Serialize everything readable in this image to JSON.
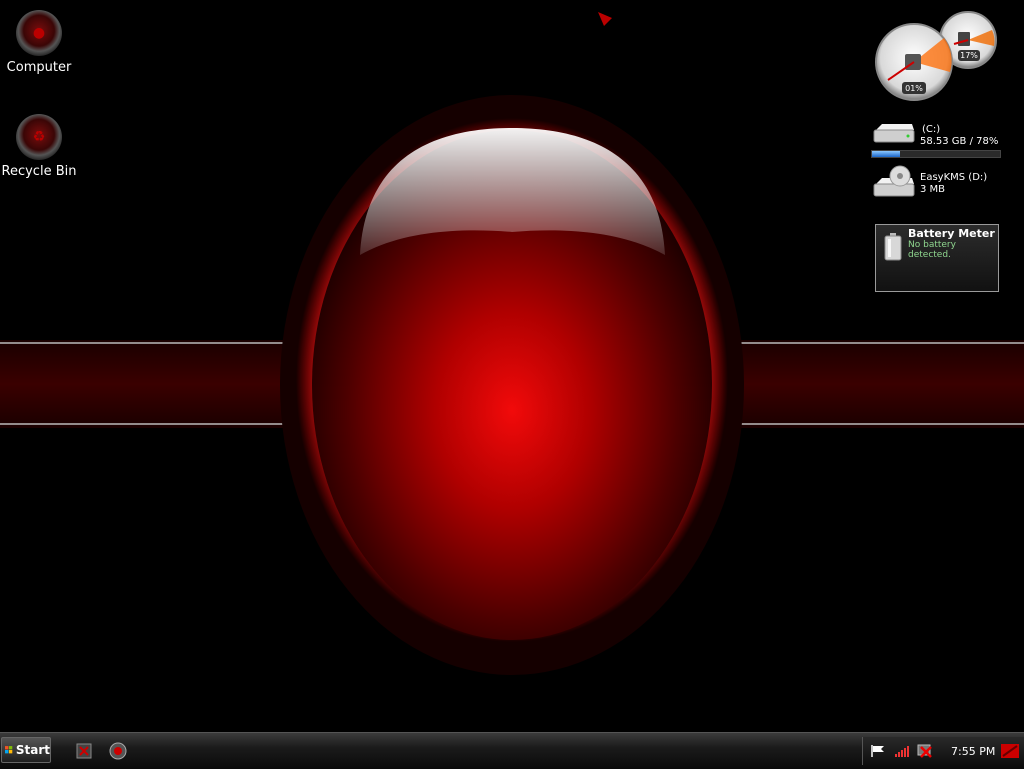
{
  "desktop": {
    "icons": [
      {
        "label": "Computer",
        "icon": "computer-icon"
      },
      {
        "label": "Recycle Bin",
        "icon": "recycle-bin-icon"
      }
    ]
  },
  "gadgets": {
    "cpu_meter": {
      "cpu_label": "01%",
      "memory_label": "17%",
      "cpu_percent": 1,
      "memory_percent": 17
    },
    "drives": [
      {
        "name": "(C:)",
        "info": "58.53 GB / 78%",
        "used_percent": 22
      },
      {
        "name": "EasyKMS (D:)",
        "info": "3 MB"
      }
    ],
    "battery": {
      "title": "Battery Meter",
      "status": "No battery detected."
    }
  },
  "taskbar": {
    "start_label": "Start",
    "clock": "7:55 PM",
    "tray_icons": [
      "flag-icon",
      "signal-icon",
      "network-disconnected-icon",
      "show-desktop-icon"
    ]
  },
  "colors": {
    "accent_red": "#e00000",
    "background": "#000000",
    "taskbar": "#1b1b1b"
  }
}
